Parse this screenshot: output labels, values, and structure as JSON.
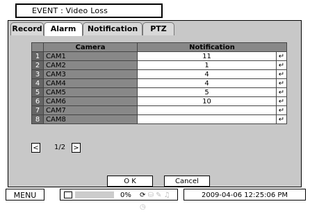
{
  "title": "EVENT : Video Loss",
  "tabs": [
    {
      "label": "Record"
    },
    {
      "label": "Alarm"
    },
    {
      "label": "Notification"
    },
    {
      "label": "PTZ"
    }
  ],
  "table": {
    "headers": {
      "camera": "Camera",
      "notification": "Notification"
    },
    "rows": [
      {
        "num": "1",
        "camera": "CAM1",
        "notification": "11"
      },
      {
        "num": "2",
        "camera": "CAM2",
        "notification": "1"
      },
      {
        "num": "3",
        "camera": "CAM3",
        "notification": "4"
      },
      {
        "num": "4",
        "camera": "CAM4",
        "notification": "4"
      },
      {
        "num": "5",
        "camera": "CAM5",
        "notification": "5"
      },
      {
        "num": "6",
        "camera": "CAM6",
        "notification": "10"
      },
      {
        "num": "7",
        "camera": "CAM7",
        "notification": ""
      },
      {
        "num": "8",
        "camera": "CAM8",
        "notification": ""
      }
    ],
    "enter_glyph": "↵"
  },
  "pager": {
    "prev": "<",
    "next": ">",
    "page": "1/2"
  },
  "buttons": {
    "ok": "O K",
    "cancel": "Cancel"
  },
  "status": {
    "menu": "MENU",
    "disk_usage": "0%",
    "datetime": "2009-04-06 12:25:06 PM"
  }
}
